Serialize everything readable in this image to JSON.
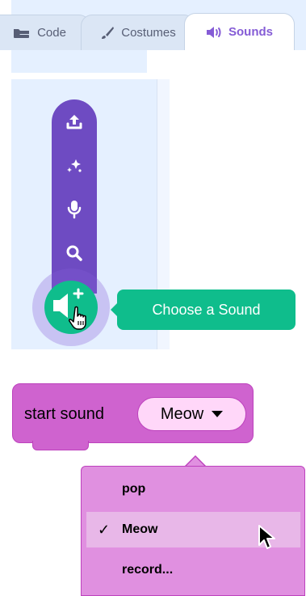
{
  "tabs": [
    {
      "label": "Code",
      "icon": "code-blocks-icon"
    },
    {
      "label": "Costumes",
      "icon": "paintbrush-icon"
    },
    {
      "label": "Sounds",
      "icon": "speaker-icon"
    }
  ],
  "sound_menu": {
    "buttons": [
      {
        "name": "upload-sound",
        "icon": "upload-icon"
      },
      {
        "name": "surprise",
        "icon": "sparkle-icon"
      },
      {
        "name": "record",
        "icon": "microphone-icon"
      },
      {
        "name": "choose",
        "icon": "search-icon"
      }
    ],
    "main_icon": "add-sound-icon",
    "tooltip": "Choose a Sound"
  },
  "block": {
    "label": "start sound",
    "field_value": "Meow"
  },
  "dropdown": {
    "items": [
      "pop",
      "Meow",
      "record..."
    ],
    "selected_mark": "✓"
  },
  "colors": {
    "accent": "#855cd6",
    "menu": "#6e4bc2",
    "green": "#0fbd8c",
    "sound_block": "#cf63cf",
    "field_bg": "#ffd7f9"
  }
}
